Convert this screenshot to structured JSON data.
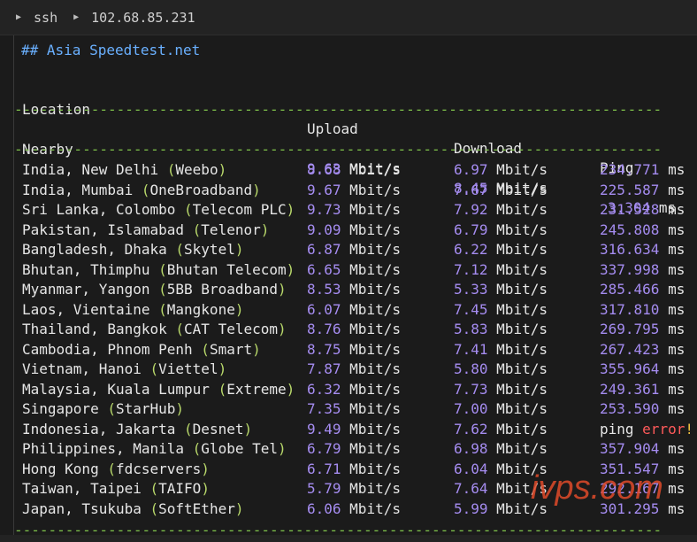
{
  "titlebar": {
    "item1": "ssh",
    "item2": "102.68.85.231"
  },
  "heading": "## Asia Speedtest.net",
  "columns": {
    "location": "Location",
    "upload": "Upload",
    "download": "Download",
    "ping": "Ping"
  },
  "separator": "--------------------------------------------------------------------------------------------",
  "unit_speed": "Mbit/s",
  "unit_ping": "ms",
  "nearby": {
    "location": "Nearby",
    "upload": "9.63",
    "download": "8.45",
    "ping": "3.304"
  },
  "rows": [
    {
      "place": "India, New Delhi ",
      "isp": "Weebo",
      "upload": "8.68",
      "download": "6.97",
      "ping": "234.771"
    },
    {
      "place": "India, Mumbai ",
      "isp": "OneBroadband",
      "upload": "9.67",
      "download": "7.67",
      "ping": "225.587"
    },
    {
      "place": "Sri Lanka, Colombo ",
      "isp": "Telecom PLC",
      "upload": "9.73",
      "download": "7.92",
      "ping": "231.528"
    },
    {
      "place": "Pakistan, Islamabad ",
      "isp": "Telenor",
      "upload": "9.09",
      "download": "6.79",
      "ping": "245.808"
    },
    {
      "place": "Bangladesh, Dhaka ",
      "isp": "Skytel",
      "upload": "6.87",
      "download": "6.22",
      "ping": "316.634"
    },
    {
      "place": "Bhutan, Thimphu ",
      "isp": "Bhutan Telecom",
      "upload": "6.65",
      "download": "7.12",
      "ping": "337.998"
    },
    {
      "place": "Myanmar, Yangon ",
      "isp": "5BB Broadband",
      "upload": "8.53",
      "download": "5.33",
      "ping": "285.466"
    },
    {
      "place": "Laos, Vientaine ",
      "isp": "Mangkone",
      "upload": "6.07",
      "download": "7.45",
      "ping": "317.810"
    },
    {
      "place": "Thailand, Bangkok ",
      "isp": "CAT Telecom",
      "upload": "8.76",
      "download": "5.83",
      "ping": "269.795"
    },
    {
      "place": "Cambodia, Phnom Penh ",
      "isp": "Smart",
      "upload": "8.75",
      "download": "7.41",
      "ping": "267.423"
    },
    {
      "place": "Vietnam, Hanoi ",
      "isp": "Viettel",
      "upload": "7.87",
      "download": "5.80",
      "ping": "355.964"
    },
    {
      "place": "Malaysia, Kuala Lumpur ",
      "isp": "Extreme",
      "upload": "6.32",
      "download": "7.73",
      "ping": "249.361"
    },
    {
      "place": "Singapore ",
      "isp": "StarHub",
      "upload": "7.35",
      "download": "7.00",
      "ping": "253.590"
    },
    {
      "place": "Indonesia, Jakarta ",
      "isp": "Desnet",
      "upload": "9.49",
      "download": "7.62",
      "ping_error": true,
      "ping_word": "ping",
      "error_word": "error",
      "excl": "!"
    },
    {
      "place": "Philippines, Manila ",
      "isp": "Globe Tel",
      "upload": "6.79",
      "download": "6.98",
      "ping": "357.904"
    },
    {
      "place": "Hong Kong ",
      "isp": "fdcservers",
      "upload": "6.71",
      "download": "6.04",
      "ping": "351.547"
    },
    {
      "place": "Taiwan, Taipei ",
      "isp": "TAIFO",
      "upload": "5.79",
      "download": "7.64",
      "ping": "292.167"
    },
    {
      "place": "Japan, Tsukuba ",
      "isp": "SoftEther",
      "upload": "6.06",
      "download": "5.99",
      "ping": "301.295"
    }
  ],
  "watermark": "ivps.com"
}
